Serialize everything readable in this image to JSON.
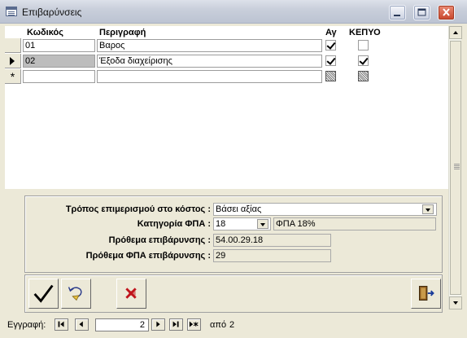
{
  "window": {
    "title": "Επιβαρύνσεις"
  },
  "grid": {
    "columns": {
      "code": "Κωδικός",
      "description": "Περιγραφή",
      "ag": "Αγ",
      "kepyo": "ΚΕΠΥΟ"
    },
    "rows": [
      {
        "code": "01",
        "description": "Βαρος",
        "ag": true,
        "kepyo": false,
        "current": false
      },
      {
        "code": "02",
        "description": "Έξοδα διαχείρισης",
        "ag": true,
        "kepyo": true,
        "current": true
      },
      {
        "code": "",
        "description": "",
        "ag": null,
        "kepyo": null,
        "new_record": true
      }
    ]
  },
  "details": {
    "allocation_label": "Τρόπος επιμερισμού στο κόστος :",
    "allocation_value": "Βάσει αξίας",
    "vat_category_label": "Κατηγορία ΦΠΑ :",
    "vat_category_code": "18",
    "vat_category_name": "ΦΠΑ 18%",
    "charge_prefix_label": "Πρόθεμα επιβάρυνσης :",
    "charge_prefix_value": "54.00.29.18",
    "vat_charge_prefix_label": "Πρόθεμα ΦΠΑ επιβάρυνσης :",
    "vat_charge_prefix_value": "29"
  },
  "toolbar": {
    "buttons": [
      "save-checkmark",
      "undo",
      "delete",
      "exit-door"
    ]
  },
  "navigator": {
    "label": "Εγγραφή:",
    "current_record": "2",
    "of_label": "από",
    "total_records": "2"
  },
  "colors": {
    "window_bg": "#ece9d8",
    "selected_cell": "#bdbdbd",
    "delete_red": "#c0141c"
  }
}
